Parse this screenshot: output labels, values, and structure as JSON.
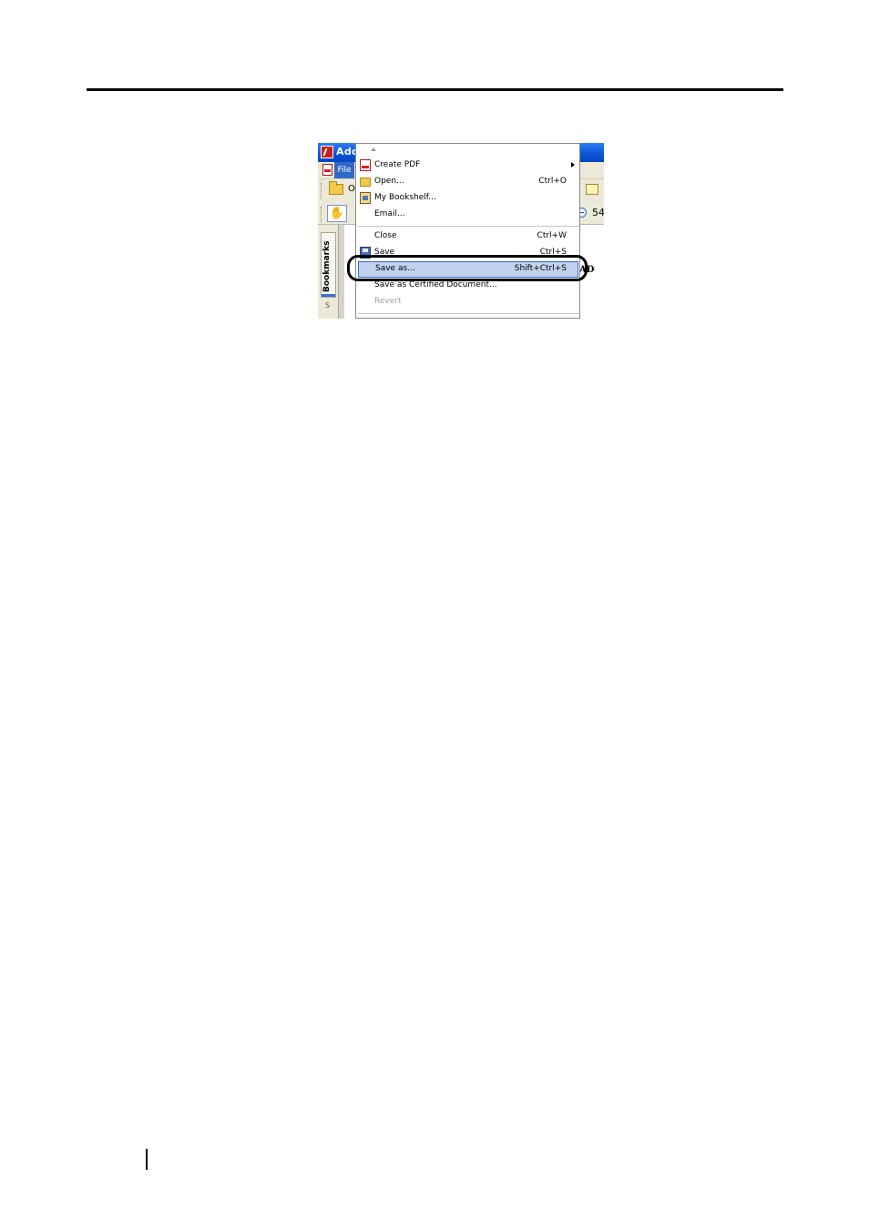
{
  "window": {
    "title": "Adol",
    "toolbar_open_partial": "O",
    "zoom_partial": "54",
    "nav_tab_label": "Bookmarks",
    "nav_tab_second_partial": "S",
    "doc_text_partial": "AD"
  },
  "menubar": {
    "file_label": "File"
  },
  "file_menu": {
    "items": [
      {
        "label": "Create PDF",
        "shortcut": "",
        "submenu": true,
        "icon": "pdf-icon"
      },
      {
        "label": "Open...",
        "shortcut": "Ctrl+O",
        "icon": "open-folder-icon"
      },
      {
        "label": "My Bookshelf...",
        "shortcut": "",
        "icon": "bookshelf-icon"
      },
      {
        "label": "Email...",
        "shortcut": ""
      },
      {
        "label": "Close",
        "shortcut": "Ctrl+W"
      },
      {
        "label": "Save",
        "shortcut": "Ctrl+S",
        "icon": "save-icon"
      },
      {
        "label": "Save as...",
        "shortcut": "Shift+Ctrl+S",
        "highlighted": true
      },
      {
        "label": "Save as Certified Document...",
        "shortcut": ""
      },
      {
        "label": "Revert",
        "shortcut": "",
        "disabled": true
      }
    ]
  },
  "colors": {
    "title_bar": "#0a54d6",
    "menu_highlight": "#c1d2ee",
    "menu_highlight_border": "#316ac5",
    "callout": "#000000"
  }
}
